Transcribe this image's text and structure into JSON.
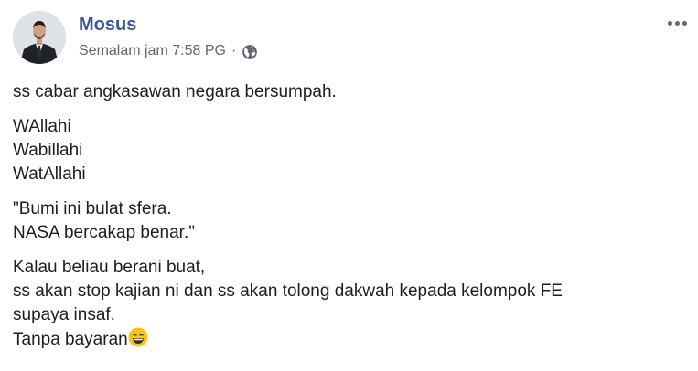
{
  "post": {
    "author": "Mosus",
    "timestamp": "Semalam jam 7:58 PG",
    "separator": "·",
    "privacy_icon": "globe-icon",
    "menu_icon": "more-options-icon",
    "accent_color": "#385898",
    "meta_color": "#616770",
    "paragraphs": [
      [
        "ss cabar angkasawan negara bersumpah."
      ],
      [
        "WAllahi",
        "Wabillahi",
        "WatAllahi"
      ],
      [
        "\"Bumi ini bulat sfera.",
        "NASA bercakap benar.\""
      ],
      [
        "Kalau beliau berani buat,",
        "ss akan stop kajian ni dan ss akan tolong dakwah kepada kelompok FE",
        "supaya insaf.",
        "Tanpa bayaran"
      ]
    ],
    "trailing_emoji": "grinning-face-emoji"
  }
}
